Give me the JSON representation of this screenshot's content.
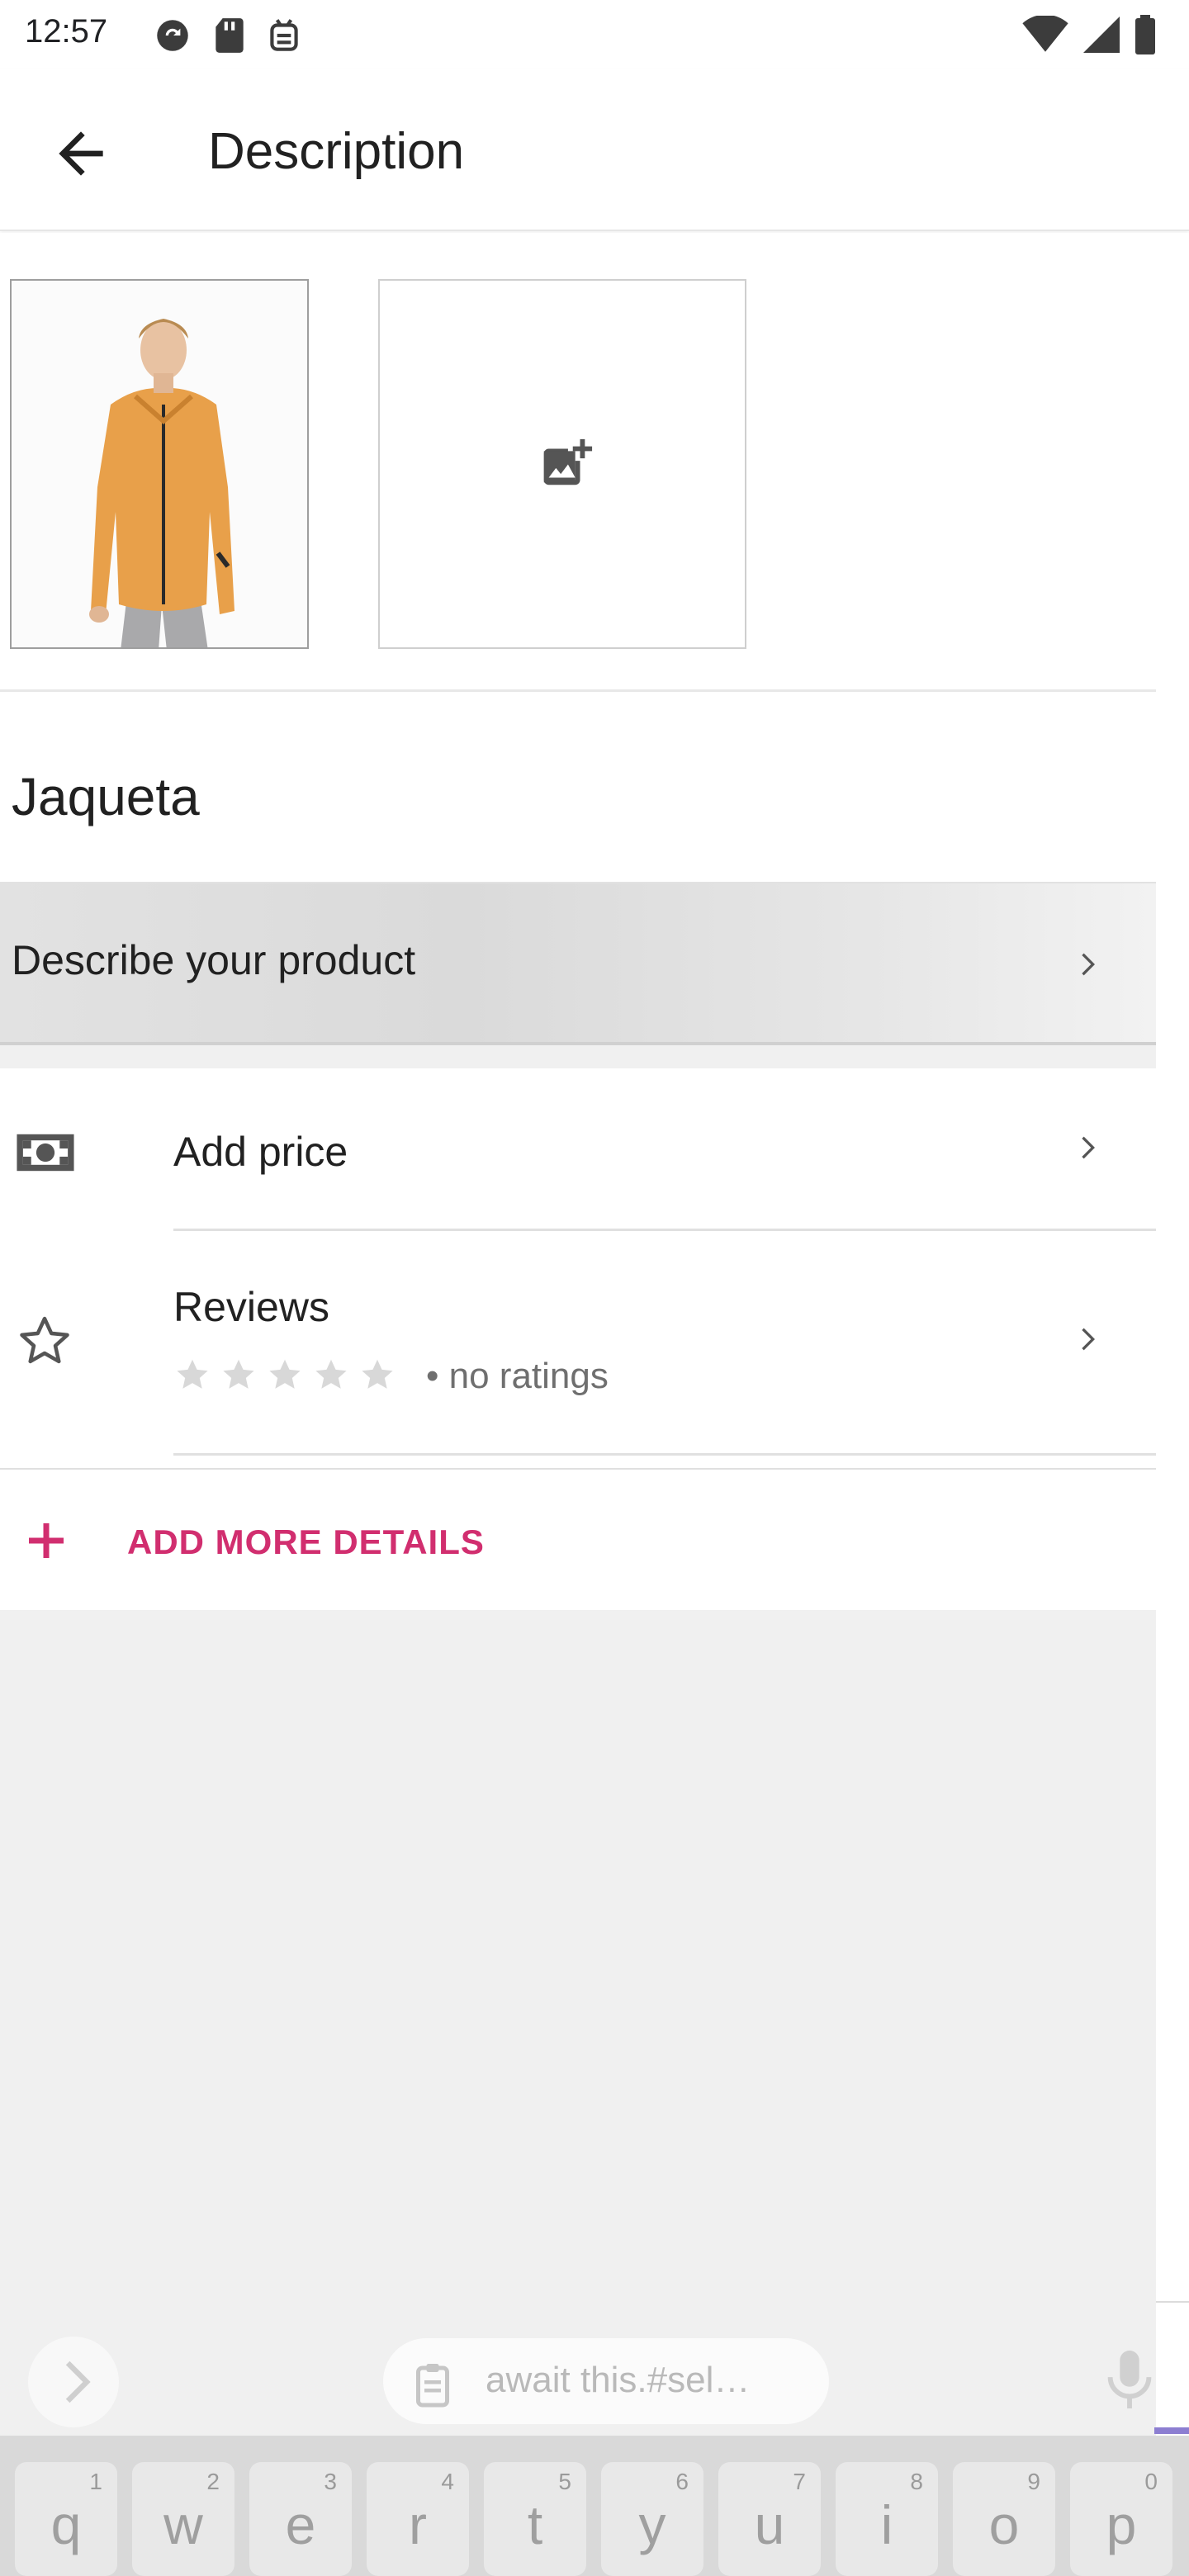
{
  "status_bar": {
    "time": "12:57",
    "icons_left": [
      "sync-icon",
      "sd-card-icon",
      "android-debug-icon"
    ],
    "icons_right": [
      "wifi-icon",
      "cell-signal-icon",
      "battery-icon"
    ]
  },
  "appbar": {
    "back_icon": "arrow-back-icon",
    "title": "Description"
  },
  "images": {
    "thumbnail_alt": "Jacket photo",
    "add_photo_icon": "add-photo-icon"
  },
  "product": {
    "name": "Jaqueta"
  },
  "description": {
    "label": "Describe your product"
  },
  "price": {
    "icon": "money-icon",
    "label": "Add price"
  },
  "reviews": {
    "icon": "star-outline-icon",
    "label": "Reviews",
    "stars": 0,
    "stars_max": 5,
    "rating_text": "• no ratings"
  },
  "more_details": {
    "label": "ADD MORE DETAILS"
  },
  "keyboard": {
    "suggestion": "await this.#sel…",
    "keys": [
      {
        "ch": "q",
        "hint": "1"
      },
      {
        "ch": "w",
        "hint": "2"
      },
      {
        "ch": "e",
        "hint": "3"
      },
      {
        "ch": "r",
        "hint": "4"
      },
      {
        "ch": "t",
        "hint": "5"
      },
      {
        "ch": "y",
        "hint": "6"
      },
      {
        "ch": "u",
        "hint": "7"
      },
      {
        "ch": "i",
        "hint": "8"
      },
      {
        "ch": "o",
        "hint": "9"
      },
      {
        "ch": "p",
        "hint": "0"
      }
    ]
  },
  "colors": {
    "accent": "#d12e6f",
    "text_primary": "#212121",
    "text_secondary": "#6f6f6f",
    "star_empty": "#d8d8d8"
  }
}
